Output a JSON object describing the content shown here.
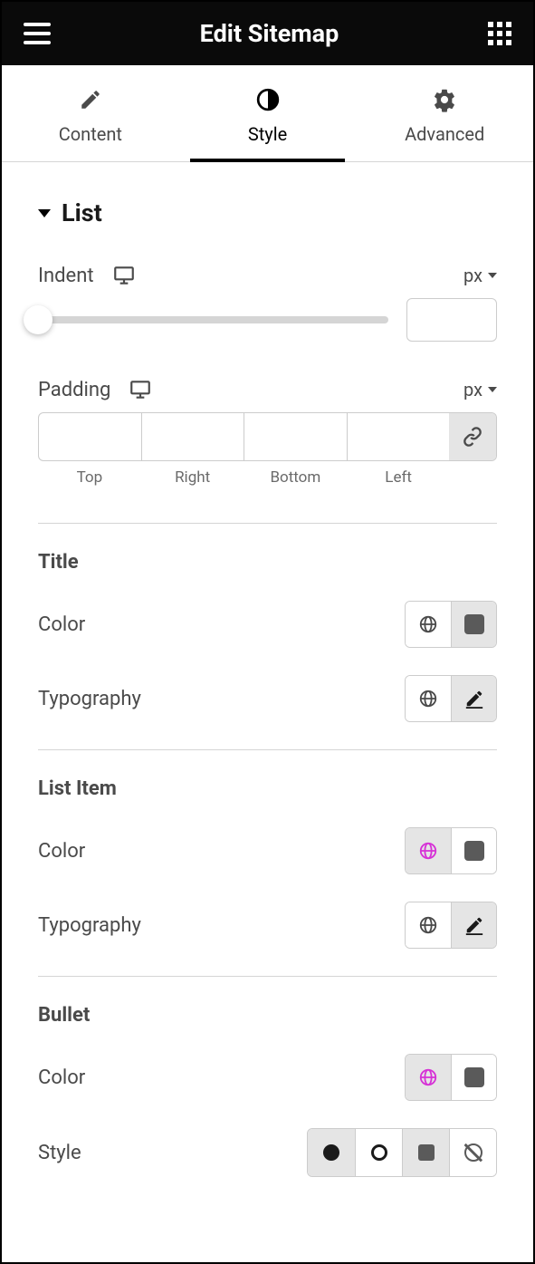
{
  "header": {
    "title": "Edit Sitemap"
  },
  "tabs": {
    "content": "Content",
    "style": "Style",
    "advanced": "Advanced",
    "active": "style"
  },
  "section": {
    "list": "List"
  },
  "controls": {
    "indent": {
      "label": "Indent",
      "unit": "px",
      "value": ""
    },
    "padding": {
      "label": "Padding",
      "unit": "px",
      "sides": {
        "top": "Top",
        "right": "Right",
        "bottom": "Bottom",
        "left": "Left"
      },
      "values": {
        "top": "",
        "right": "",
        "bottom": "",
        "left": ""
      }
    }
  },
  "subsections": {
    "title": {
      "heading": "Title",
      "color": "Color",
      "typography": "Typography"
    },
    "listItem": {
      "heading": "List Item",
      "color": "Color",
      "typography": "Typography"
    },
    "bullet": {
      "heading": "Bullet",
      "color": "Color",
      "style": "Style"
    }
  },
  "colors": {
    "magenta": "#d632d6",
    "gray": "#4a4a4a"
  }
}
